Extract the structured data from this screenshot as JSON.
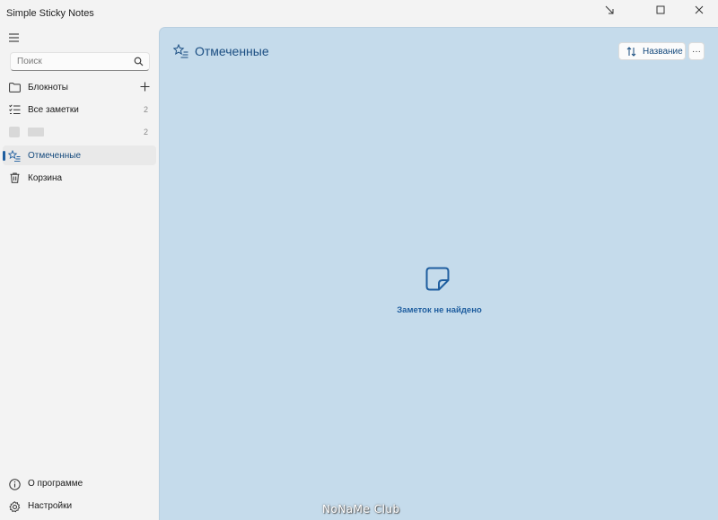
{
  "window": {
    "title": "Simple Sticky Notes"
  },
  "sidebar": {
    "search_placeholder": "Поиск",
    "items": [
      {
        "label": "Блокноты",
        "icon": "folder-icon"
      },
      {
        "label": "Все заметки",
        "count": "2",
        "icon": "checklist-icon"
      },
      {
        "label": "",
        "count": "2",
        "icon": "notebook-icon"
      },
      {
        "label": "Отмеченные",
        "icon": "star-list-icon",
        "selected": true
      },
      {
        "label": "Корзина",
        "icon": "trash-icon"
      }
    ],
    "footer": [
      {
        "label": "О программе",
        "icon": "info-icon"
      },
      {
        "label": "Настройки",
        "icon": "gear-icon"
      }
    ]
  },
  "main": {
    "title": "Отмеченные",
    "sort_label": "Название",
    "more_label": "···",
    "empty_text": "Заметок не найдено"
  },
  "watermark": "NoNaMe Club",
  "colors": {
    "accent": "#1f5e9f",
    "main_bg": "#c5dbeb",
    "sidebar_bg": "#f3f3f3"
  }
}
